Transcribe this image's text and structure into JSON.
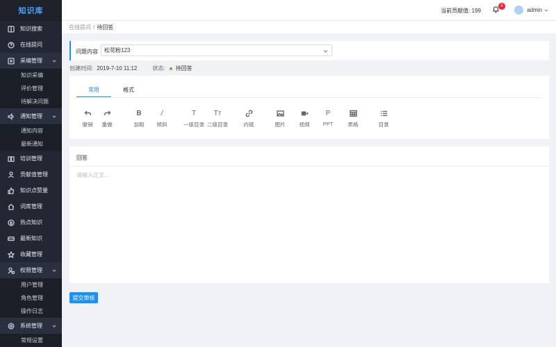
{
  "sidebar": {
    "logo": "知识库",
    "items": [
      {
        "label": "知识搜索",
        "icon": "book-icon"
      },
      {
        "label": "在线提问",
        "icon": "question-circle-icon"
      },
      {
        "label": "采编管理",
        "icon": "edit-doc-icon",
        "expanded": true,
        "children": [
          "知识采编",
          "评价管理",
          "待解决问题"
        ]
      },
      {
        "label": "通知管理",
        "icon": "sound-icon",
        "expanded": true,
        "children": [
          "通知内容",
          "最新通知"
        ]
      },
      {
        "label": "培训管理",
        "icon": "read-icon"
      },
      {
        "label": "贡献值管理",
        "icon": "team-icon"
      },
      {
        "label": "知识点赞量",
        "icon": "like-icon"
      },
      {
        "label": "词库管理",
        "icon": "home-icon"
      },
      {
        "label": "热点知识",
        "icon": "fire-icon"
      },
      {
        "label": "最新知识",
        "icon": "new-icon"
      },
      {
        "label": "收藏管理",
        "icon": "star-icon"
      },
      {
        "label": "权限管理",
        "icon": "user-lock-icon",
        "expanded": true,
        "children": [
          "用户管理",
          "角色管理",
          "操作日志"
        ]
      },
      {
        "label": "系统管理",
        "icon": "gear-icon",
        "expanded": true,
        "children": [
          "常规设置"
        ]
      }
    ]
  },
  "header": {
    "contribution_label": "当前贡献值:",
    "contribution_value": "199",
    "notification_count": "6",
    "username": "admin"
  },
  "breadcrumb": {
    "parent": "在线提问",
    "separator": "/",
    "current": "待回答"
  },
  "question": {
    "label": "问题内容",
    "value": "松花粉123"
  },
  "meta": {
    "created_label": "创建时间:",
    "created_value": "2019-7-10 11:12",
    "status_label": "状态:",
    "status_value": "待回答",
    "status_color": "#52c41a"
  },
  "editor": {
    "tabs": [
      "常用",
      "格式"
    ],
    "active_tab": 0,
    "tools": [
      {
        "label": "撤销",
        "icon": "undo-icon"
      },
      {
        "label": "重做",
        "icon": "redo-icon"
      },
      {
        "label": "加粗",
        "icon": "bold-icon",
        "glyph": "B"
      },
      {
        "label": "倾斜",
        "icon": "italic-icon",
        "glyph": "/"
      },
      {
        "label": "一级目录",
        "icon": "heading1-icon",
        "glyph": "T"
      },
      {
        "label": "二级目录",
        "icon": "heading2-icon",
        "glyph": "Tт"
      },
      {
        "label": "内链",
        "icon": "link-icon"
      },
      {
        "label": "图片",
        "icon": "image-icon"
      },
      {
        "label": "视频",
        "icon": "video-icon"
      },
      {
        "label": "PPT",
        "icon": "ppt-icon",
        "glyph": "P"
      },
      {
        "label": "表格",
        "icon": "table-icon"
      },
      {
        "label": "目录",
        "icon": "list-icon"
      }
    ]
  },
  "answer": {
    "title": "回答",
    "placeholder": "请输入正文..."
  },
  "actions": {
    "submit_label": "提交审核"
  },
  "colors": {
    "accent": "#1890ff",
    "sidebar_bg": "#222733",
    "badge": "#f5222d"
  }
}
